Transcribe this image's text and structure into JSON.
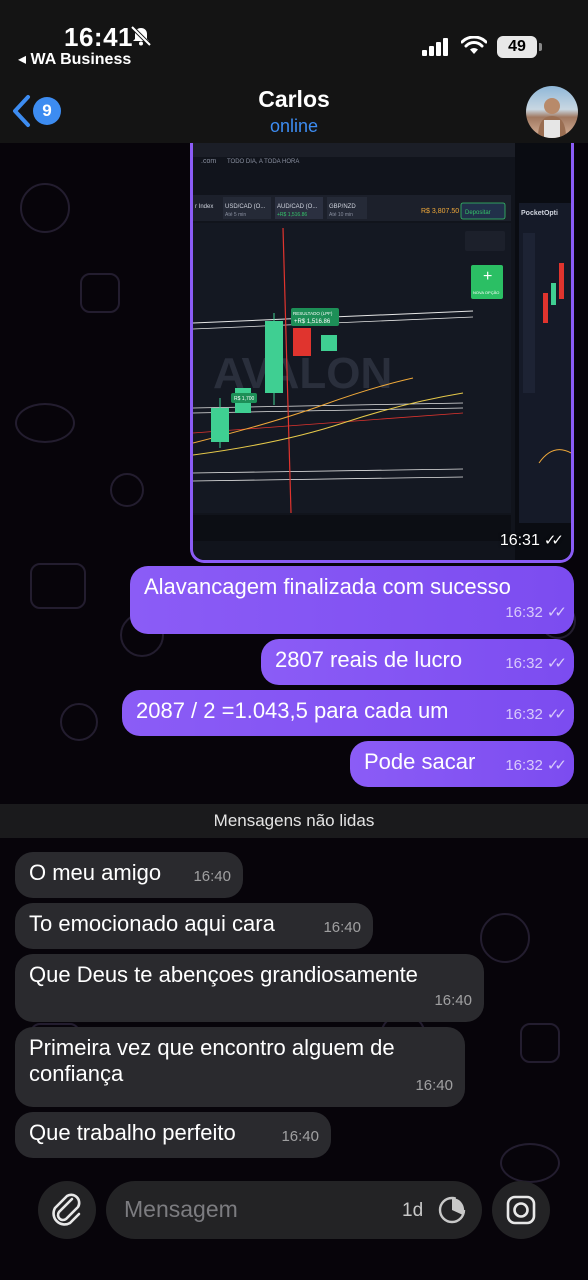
{
  "status_bar": {
    "time": "16:41",
    "back_app": "◂ WA Business",
    "battery": "49"
  },
  "header": {
    "unread_count": "9",
    "contact_name": "Carlos",
    "contact_status": "online"
  },
  "image_message": {
    "time": "16:31",
    "screenshot_text": {
      "site": ".com",
      "tagline": "TODO DIA, A TODA HORA",
      "tab1": "r Index",
      "tab2": "USD/CAD (O...",
      "tab2_sub": "Até 5 min",
      "tab3": "AUD/CAD (O...",
      "tab3_sub": "+R$ 1,516.86",
      "tab4": "GBP/NZD",
      "tab4_sub": "Até 10 min",
      "balance": "R$ 3,807.50",
      "deposit": "Depositar",
      "result": "RESULTADO (LPF)",
      "result_value": "+R$ 1,516.86",
      "price_tag": "R$ 1,700",
      "nova_opcao": "NOVA OPÇÃO",
      "watermark": "AVALON",
      "broker": "PocketOpti"
    }
  },
  "outgoing_messages": [
    {
      "text": "Alavancagem finalizada com sucesso",
      "time": "16:32"
    },
    {
      "text": "2807 reais de lucro",
      "time": "16:32"
    },
    {
      "text": "2087 / 2 =1.043,5 para cada um",
      "time": "16:32"
    },
    {
      "text": "Pode sacar",
      "time": "16:32"
    }
  ],
  "unread_divider": "Mensagens não lidas",
  "incoming_messages": [
    {
      "text": "O meu amigo",
      "time": "16:40"
    },
    {
      "text": "To emocionado aqui cara",
      "time": "16:40"
    },
    {
      "text": "Que Deus te abençoes grandiosamente",
      "time": "16:40"
    },
    {
      "text": "Primeira vez que encontro alguem de confiança",
      "time": "16:40"
    },
    {
      "text": "Que trabalho perfeito",
      "time": "16:40"
    }
  ],
  "input_bar": {
    "placeholder": "Mensagem",
    "timer_label": "1d"
  },
  "colors": {
    "accent_blue": "#3d8cf1",
    "outgoing_bubble": "#8b5cf6",
    "incoming_bubble": "#2a2a2e"
  }
}
